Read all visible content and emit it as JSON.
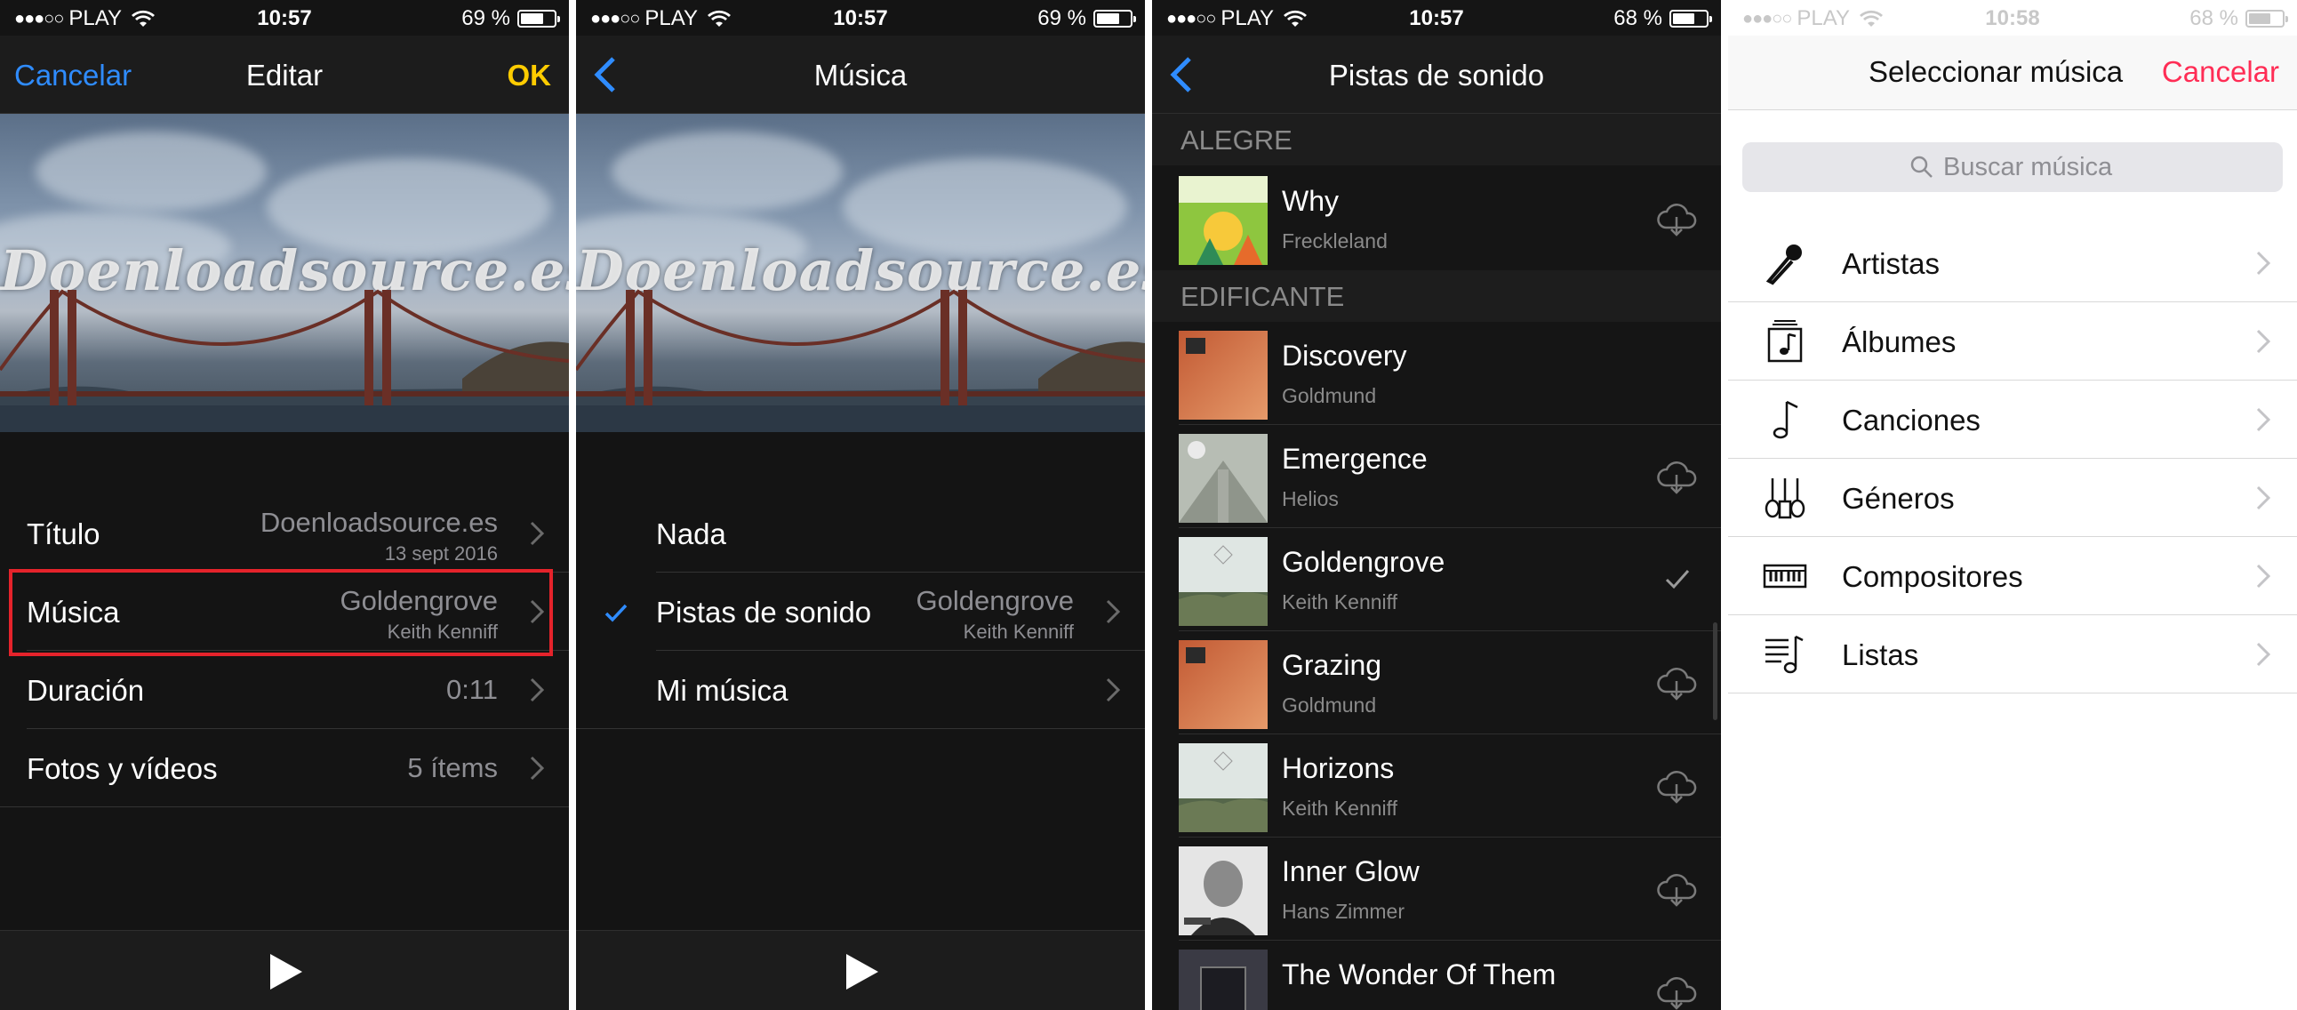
{
  "status_bars": [
    {
      "carrier": "PLAY",
      "time": "10:57",
      "battery": "69 %",
      "battery_level": 0.69
    },
    {
      "carrier": "PLAY",
      "time": "10:57",
      "battery": "69 %",
      "battery_level": 0.69
    },
    {
      "carrier": "PLAY",
      "time": "10:57",
      "battery": "68 %",
      "battery_level": 0.68
    },
    {
      "carrier": "PLAY",
      "time": "10:58",
      "battery": "68 %",
      "battery_level": 0.68
    }
  ],
  "edit": {
    "cancel": "Cancelar",
    "title": "Editar",
    "ok": "OK",
    "watermark": "Doenloadsource.es",
    "rows": [
      {
        "label": "Título",
        "value": "Doenloadsource.es",
        "sub": "13 sept 2016"
      },
      {
        "label": "Música",
        "value": "Goldengrove",
        "sub": "Keith Kenniff"
      },
      {
        "label": "Duración",
        "value": "0:11",
        "sub": ""
      },
      {
        "label": "Fotos y vídeos",
        "value": "5 ítems",
        "sub": ""
      }
    ]
  },
  "music": {
    "title": "Música",
    "watermark": "Doenloadsource.es",
    "rows": [
      {
        "label": "Nada",
        "value": "",
        "sub": ""
      },
      {
        "label": "Pistas de sonido",
        "value": "Goldengrove",
        "sub": "Keith Kenniff",
        "checked": true
      },
      {
        "label": "Mi música",
        "value": "",
        "sub": ""
      }
    ]
  },
  "soundtracks": {
    "title": "Pistas de sonido",
    "sections": [
      {
        "name": "ALEGRE"
      },
      {
        "name": "EDIFICANTE"
      }
    ],
    "tracks": [
      {
        "title": "Why",
        "artist": "Freckleland",
        "status": "cloud-download"
      },
      {
        "title": "Discovery",
        "artist": "Goldmund",
        "status": "none"
      },
      {
        "title": "Emergence",
        "artist": "Helios",
        "status": "cloud-download"
      },
      {
        "title": "Goldengrove",
        "artist": "Keith Kenniff",
        "status": "selected"
      },
      {
        "title": "Grazing",
        "artist": "Goldmund",
        "status": "cloud-download"
      },
      {
        "title": "Horizons",
        "artist": "Keith Kenniff",
        "status": "cloud-download"
      },
      {
        "title": "Inner Glow",
        "artist": "Hans Zimmer",
        "status": "cloud-download"
      },
      {
        "title": "The Wonder Of Them",
        "artist": "",
        "status": "cloud-download"
      }
    ]
  },
  "select_music": {
    "title": "Seleccionar música",
    "cancel": "Cancelar",
    "search_placeholder": "Buscar música",
    "items": [
      {
        "label": "Artistas",
        "icon": "microphone-icon"
      },
      {
        "label": "Álbumes",
        "icon": "album-icon"
      },
      {
        "label": "Canciones",
        "icon": "music-note-icon"
      },
      {
        "label": "Géneros",
        "icon": "genres-icon"
      },
      {
        "label": "Compositores",
        "icon": "piano-icon"
      },
      {
        "label": "Listas",
        "icon": "playlist-icon"
      }
    ]
  },
  "colors": {
    "ios_blue": "#2f8cff",
    "ok_yellow": "#ffcc00",
    "cancel_pink": "#ff2d55",
    "highlight_red": "#e5232b"
  }
}
